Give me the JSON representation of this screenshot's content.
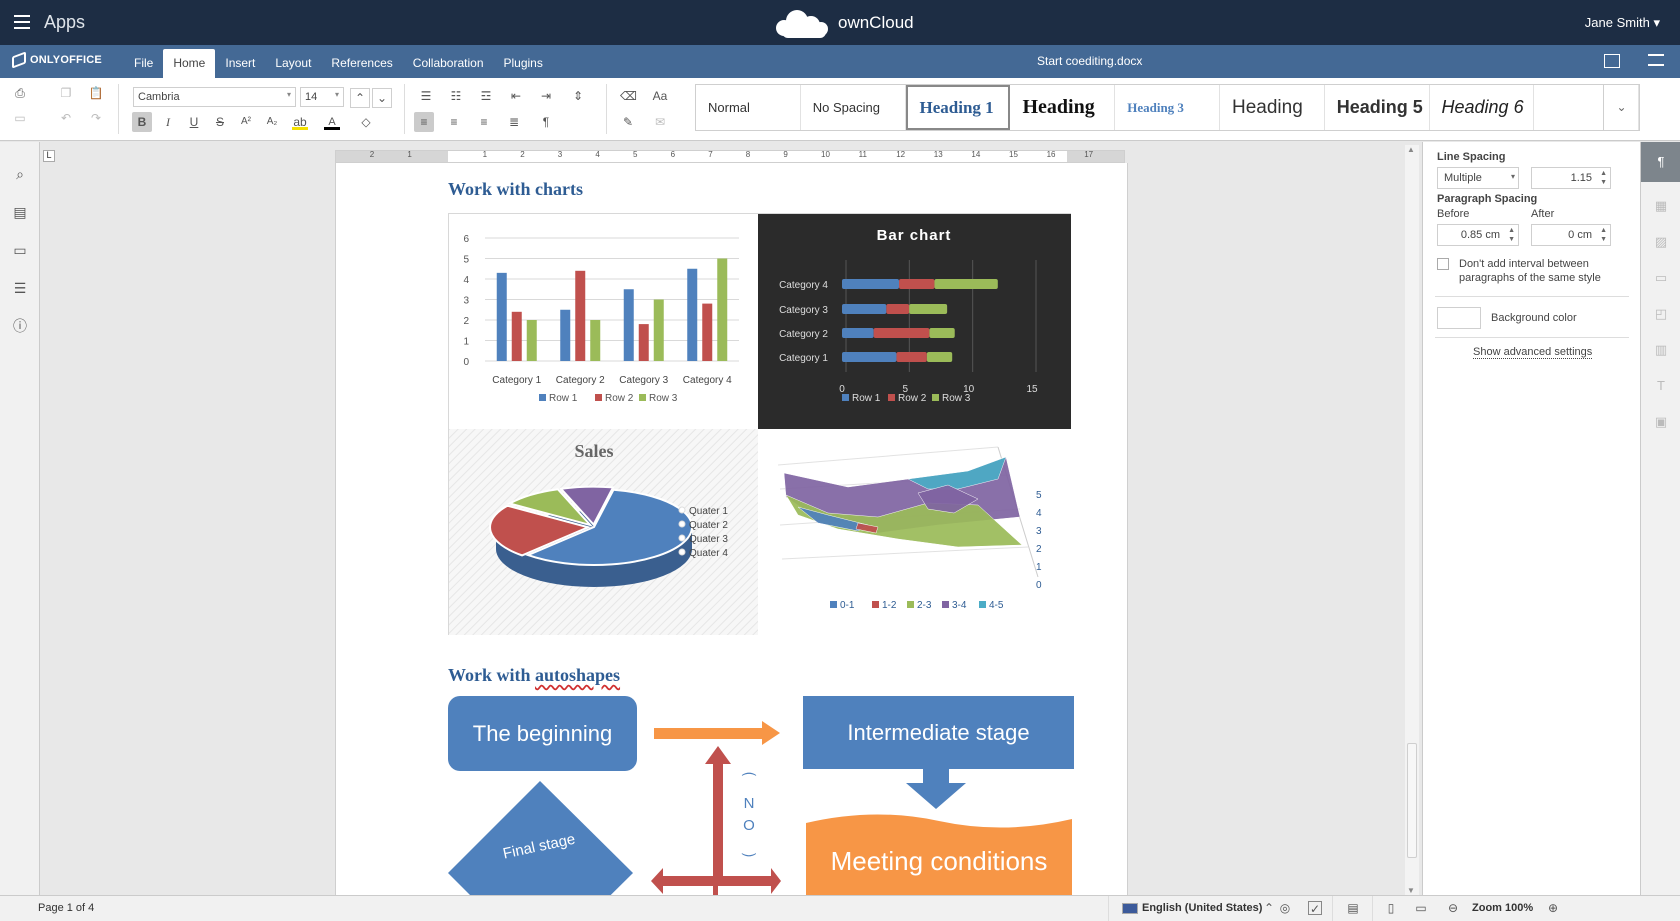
{
  "owncloud": {
    "apps_label": "Apps",
    "brand": "ownCloud",
    "user": "Jane Smith"
  },
  "editor": {
    "logo": "ONLYOFFICE",
    "tabs": [
      "File",
      "Home",
      "Insert",
      "Layout",
      "References",
      "Collaboration",
      "Plugins"
    ],
    "active_tab": "Home",
    "document_name": "Start coediting.docx"
  },
  "toolbar": {
    "font_name": "Cambria",
    "font_size": "14",
    "styles": [
      "Normal",
      "No Spacing",
      "Heading 1",
      "Heading",
      "Heading 3",
      "Heading",
      "Heading 5",
      "Heading 6",
      ""
    ],
    "icons": [
      "print-icon",
      "save-icon",
      "copy-icon",
      "paste-icon",
      "undo-icon",
      "redo-icon",
      "bold-icon",
      "italic-icon",
      "underline-icon",
      "strikethrough-icon",
      "superscript-icon",
      "subscript-icon",
      "highlight-icon",
      "font-color-icon",
      "shading-icon",
      "bullets-icon",
      "numbering-icon",
      "multilevel-icon",
      "decrease-indent-icon",
      "increase-indent-icon",
      "line-spacing-icon",
      "align-left-icon",
      "align-center-icon",
      "align-right-icon",
      "justify-icon",
      "nonprinting-icon",
      "clear-style-icon",
      "copy-style-icon",
      "change-case-icon"
    ],
    "bold_glyph": "B",
    "italic_glyph": "I",
    "underline_glyph": "U",
    "strike_glyph": "S",
    "super_glyph": "A²",
    "sub_glyph": "A₂"
  },
  "document": {
    "heading_charts": "Work with charts",
    "heading_shapes_prefix": "Work with ",
    "heading_shapes_word": "autoshapes",
    "shapes": {
      "beginning": "The beginning",
      "intermediate": "Intermediate stage",
      "final": "Final stage",
      "meeting": "Meeting conditions",
      "no": [
        "N",
        "O"
      ]
    }
  },
  "chart_data": [
    {
      "type": "bar",
      "title": "",
      "categories": [
        "Category 1",
        "Category 2",
        "Category 3",
        "Category 4"
      ],
      "series": [
        {
          "name": "Row 1",
          "values": [
            4.3,
            2.5,
            3.5,
            4.5
          ]
        },
        {
          "name": "Row 2",
          "values": [
            2.4,
            4.4,
            1.8,
            2.8
          ]
        },
        {
          "name": "Row 3",
          "values": [
            2,
            2,
            3,
            5
          ]
        }
      ],
      "ylim": [
        0,
        6
      ],
      "yticks": [
        "0",
        "1",
        "2",
        "3",
        "4",
        "5",
        "6"
      ],
      "legend": "bottom",
      "colors": [
        "#4f81bd",
        "#c0504d",
        "#9bbb59"
      ]
    },
    {
      "type": "bar",
      "orientation": "horizontal-stacked",
      "title": "Bar chart",
      "categories": [
        "Category 1",
        "Category 2",
        "Category 3",
        "Category 4"
      ],
      "series": [
        {
          "name": "Row 1",
          "values": [
            4.3,
            2.5,
            3.5,
            4.5
          ]
        },
        {
          "name": "Row 2",
          "values": [
            2.4,
            4.4,
            1.8,
            2.8
          ]
        },
        {
          "name": "Row 3",
          "values": [
            2,
            2,
            3,
            5
          ]
        }
      ],
      "xlim": [
        0,
        15
      ],
      "xticks": [
        "0",
        "5",
        "10",
        "15"
      ],
      "legend": "bottom",
      "background": "#2b2b2b"
    },
    {
      "type": "pie",
      "title": "Sales",
      "labels": [
        "Quater 1",
        "Quater 2",
        "Quater 3",
        "Quater 4"
      ],
      "values": [
        8.2,
        3.2,
        1.4,
        1.2
      ],
      "colors": [
        "#4f81bd",
        "#c0504d",
        "#9bbb59",
        "#8064a2"
      ],
      "legend": "right"
    },
    {
      "type": "area",
      "subtype": "3d-surface",
      "title": "",
      "series": [
        {
          "name": "0-1"
        },
        {
          "name": "1-2"
        },
        {
          "name": "2-3"
        },
        {
          "name": "3-4"
        },
        {
          "name": "4-5"
        }
      ],
      "zticks": [
        "0",
        "1",
        "2",
        "3",
        "4",
        "5"
      ],
      "legend": "bottom",
      "colors": [
        "#4f81bd",
        "#c0504d",
        "#9bbb59",
        "#8064a2",
        "#4bacc6"
      ]
    }
  ],
  "right_panel": {
    "line_spacing_label": "Line Spacing",
    "line_spacing_mode": "Multiple",
    "line_spacing_value": "1.15",
    "paragraph_spacing_label": "Paragraph Spacing",
    "before_label": "Before",
    "before_value": "0.85 cm",
    "after_label": "After",
    "after_value": "0 cm",
    "dont_add_interval": "Don't add interval between paragraphs of the same style",
    "background_color": "Background color",
    "advanced_settings": "Show advanced settings"
  },
  "ruler": {
    "ticks": [
      "2",
      "1",
      "1",
      "2",
      "3",
      "4",
      "5",
      "6",
      "7",
      "8",
      "9",
      "10",
      "11",
      "12",
      "13",
      "14",
      "15",
      "16",
      "17"
    ]
  },
  "status": {
    "page": "Page 1 of 4",
    "language": "English (United States)",
    "zoom": "Zoom 100%"
  }
}
